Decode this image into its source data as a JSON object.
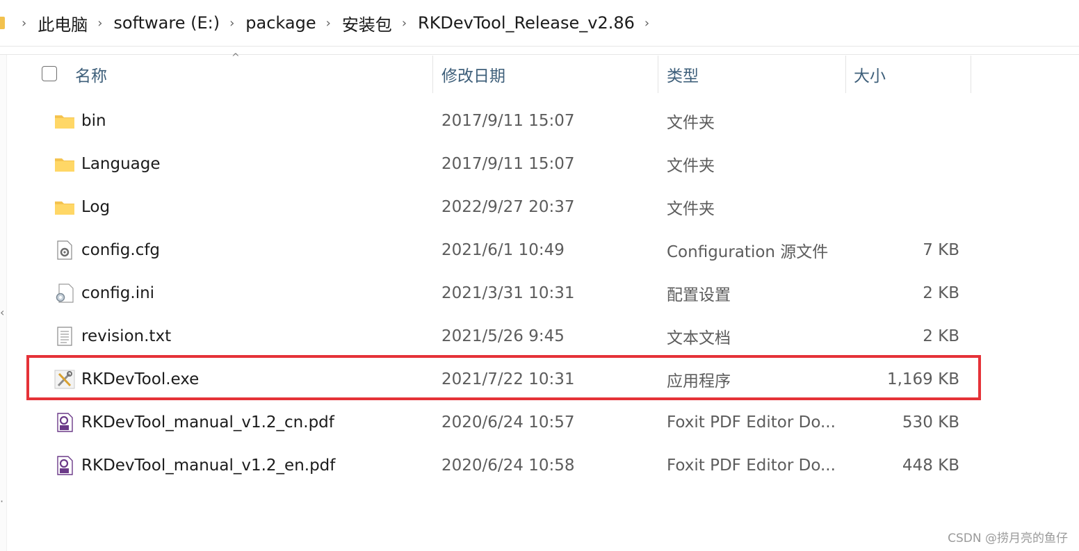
{
  "breadcrumb": {
    "items": [
      "此电脑",
      "software (E:)",
      "package",
      "安装包",
      "RKDevTool_Release_v2.86"
    ]
  },
  "columns": {
    "name": "名称",
    "date": "修改日期",
    "type": "类型",
    "size": "大小"
  },
  "files": [
    {
      "name": "bin",
      "date": "2017/9/11 15:07",
      "type": "文件夹",
      "size": "",
      "icon": "folder-icon"
    },
    {
      "name": "Language",
      "date": "2017/9/11 15:07",
      "type": "文件夹",
      "size": "",
      "icon": "folder-icon"
    },
    {
      "name": "Log",
      "date": "2022/9/27 20:37",
      "type": "文件夹",
      "size": "",
      "icon": "folder-icon"
    },
    {
      "name": "config.cfg",
      "date": "2021/6/1 10:49",
      "type": "Configuration 源文件",
      "size": "7 KB",
      "icon": "config-file-icon"
    },
    {
      "name": "config.ini",
      "date": "2021/3/31 10:31",
      "type": "配置设置",
      "size": "2 KB",
      "icon": "ini-settings-icon"
    },
    {
      "name": "revision.txt",
      "date": "2021/5/26 9:45",
      "type": "文本文档",
      "size": "2 KB",
      "icon": "text-file-icon"
    },
    {
      "name": "RKDevTool.exe",
      "date": "2021/7/22 10:31",
      "type": "应用程序",
      "size": "1,169 KB",
      "icon": "tools-exe-icon"
    },
    {
      "name": "RKDevTool_manual_v1.2_cn.pdf",
      "date": "2020/6/24 10:57",
      "type": "Foxit PDF Editor Do...",
      "size": "530 KB",
      "icon": "pdf-icon"
    },
    {
      "name": "RKDevTool_manual_v1.2_en.pdf",
      "date": "2020/6/24 10:58",
      "type": "Foxit PDF Editor Do...",
      "size": "448 KB",
      "icon": "pdf-icon"
    }
  ],
  "highlight_color": "#e53238",
  "watermark": "CSDN @捞月亮的鱼仔"
}
